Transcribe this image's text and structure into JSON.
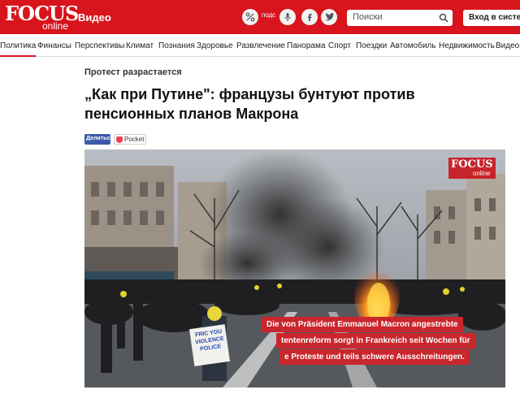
{
  "header": {
    "logo_main": "FOCUS",
    "logo_sub": "online",
    "section": "Видео",
    "podcast_label": "подс",
    "search_placeholder": "Поиски",
    "login_label": "Вход в систем"
  },
  "nav": {
    "items": [
      "Политика",
      "Финансы",
      "Перспективы",
      "Климат",
      "Познания",
      "Здоровье",
      "Развлечение",
      "Панорама",
      "Спорт",
      "Поездки",
      "Автомобиль",
      "Недвижимость",
      "Видео"
    ]
  },
  "article": {
    "kicker": "Протест разрастается",
    "headline": "„Как при Путине\": французы бунтуют против пенсионных планов Макрона",
    "share_label": "Делиться",
    "pocket_label": "Pocket"
  },
  "video": {
    "logo_main": "FOCUS",
    "logo_sub": "online",
    "sign_text": [
      "FRIC YOU",
      "VIOLENCE",
      "POLICE"
    ],
    "caption_lines": [
      "Die von Präsident Emmanuel Macron angestrebte",
      "tentenreform sorgt in Frankreich seit Wochen für",
      "e Proteste und teils schwere Ausschreitungen."
    ]
  },
  "colors": {
    "brand_red": "#d8141c",
    "caption_red": "#c9262d"
  }
}
